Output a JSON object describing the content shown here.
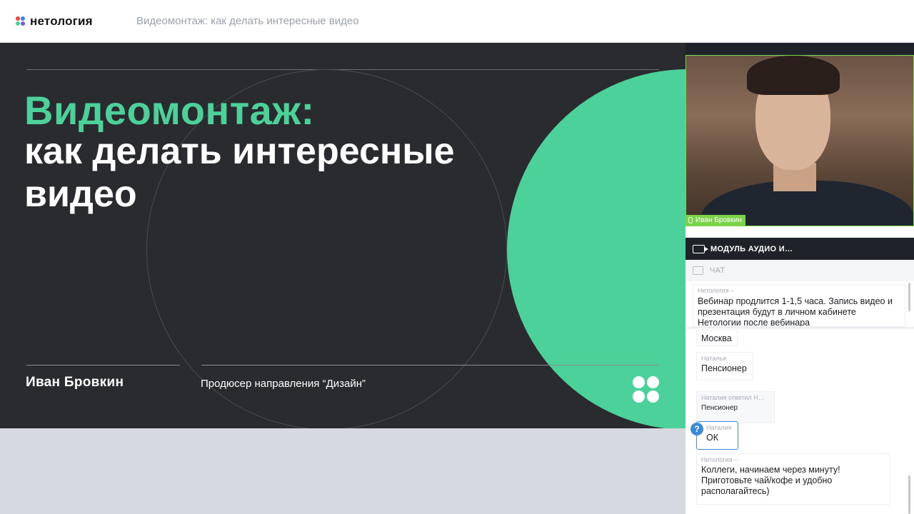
{
  "brand": {
    "name": "нетология",
    "dot_colors": [
      "#f0433a",
      "#3a7ff0",
      "#4dd19b",
      "#7a5af0"
    ]
  },
  "header": {
    "title": "Видеомонтаж: как делать интересные видео"
  },
  "slide": {
    "title_accent": "Видеомонтаж:",
    "title_main": "как делать интересные видео",
    "speaker": "Иван Бровкин",
    "role": "Продюсер направления “Дизайн”",
    "accent_color": "#4dd19b",
    "background_color": "#2a2b2f"
  },
  "video": {
    "participant_name": "Иван Бровкин",
    "mic_icon": "microphone-icon"
  },
  "modules": {
    "audio_video_label": "МОДУЛЬ АУДИО И…",
    "chat_label": "ЧАТ"
  },
  "chat": {
    "pinned": {
      "author": "Нетология –",
      "text": "Вебинар продлится 1-1,5 часа. Запись видео и презентация будут в личном кабинете Нетологии после вебинара"
    },
    "messages": [
      {
        "author": "",
        "text": "Москва"
      },
      {
        "author": "Наталья",
        "text": "Пенсионер"
      },
      {
        "author": "Наталия ответил Н…",
        "text": "Пенсионер"
      },
      {
        "author": "Наталия",
        "text": "ОК",
        "question_badge": "?"
      },
      {
        "author": "Нетология –",
        "text": "Коллеги, начинаем через минуту! Приготовьте чай/кофе и удобно располагайтесь)"
      }
    ],
    "watermark": "meeting"
  }
}
